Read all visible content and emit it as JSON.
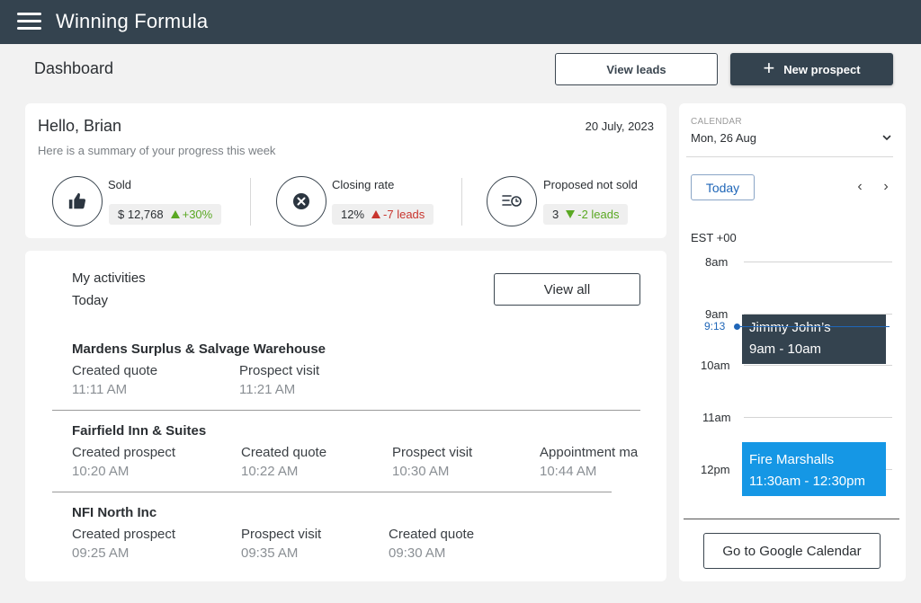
{
  "header": {
    "app_title": "Winning Formula",
    "menu_icon": "hamburger-menu-icon"
  },
  "toolbar": {
    "page_title": "Dashboard",
    "view_leads_label": "View leads",
    "new_prospect_label": "New prospect"
  },
  "summary": {
    "greeting": "Hello, Brian",
    "date": "20 July, 2023",
    "subtitle": "Here is a summary of your progress this week",
    "stats": [
      {
        "label": "Sold",
        "value": "$ 12,768",
        "delta": "+30%",
        "direction": "up",
        "color": "#5aa823",
        "icon": "thumbs-up-icon"
      },
      {
        "label": "Closing rate",
        "value": "12%",
        "delta": "-7 leads",
        "direction": "up",
        "color": "#c8352e",
        "icon": "close-circle-icon"
      },
      {
        "label": "Proposed not sold",
        "value": "3",
        "delta": "-2 leads",
        "direction": "down",
        "color": "#5aa823",
        "icon": "list-clock-icon"
      }
    ]
  },
  "activities": {
    "title": "My activities",
    "subtitle": "Today",
    "view_all_label": "View all",
    "items": [
      {
        "company": "Mardens Surplus & Salvage Warehouse",
        "events": [
          {
            "label": "Created quote",
            "time": "11:11 AM"
          },
          {
            "label": "Prospect visit",
            "time": "11:21 AM"
          }
        ]
      },
      {
        "company": "Fairfield Inn & Suites",
        "events": [
          {
            "label": "Created prospect",
            "time": "10:20 AM"
          },
          {
            "label": "Created quote",
            "time": "10:22 AM"
          },
          {
            "label": "Prospect visit",
            "time": "10:30 AM"
          },
          {
            "label": "Appointment ma",
            "time": "10:44 AM"
          }
        ]
      },
      {
        "company": "NFI North Inc",
        "events": [
          {
            "label": "Created prospect",
            "time": "09:25 AM"
          },
          {
            "label": "Prospect visit",
            "time": "09:35 AM"
          },
          {
            "label": "Created quote",
            "time": "09:30 AM"
          }
        ]
      }
    ]
  },
  "calendar": {
    "caption": "CALENDAR",
    "selected_date": "Mon, 26 Aug",
    "today_label": "Today",
    "prev_symbol": "‹",
    "next_symbol": "›",
    "timezone": "EST +00",
    "hours": [
      "8am",
      "9am",
      "10am",
      "11am",
      "12pm"
    ],
    "current_time": "9:13",
    "events": [
      {
        "title": "Jimmy John’s",
        "time": "9am - 10am",
        "color": "#34434f"
      },
      {
        "title": "Fire Marshalls",
        "time": "11:30am - 12:30pm",
        "color": "#1597e5"
      }
    ],
    "google_button_label": "Go to Google Calendar"
  }
}
